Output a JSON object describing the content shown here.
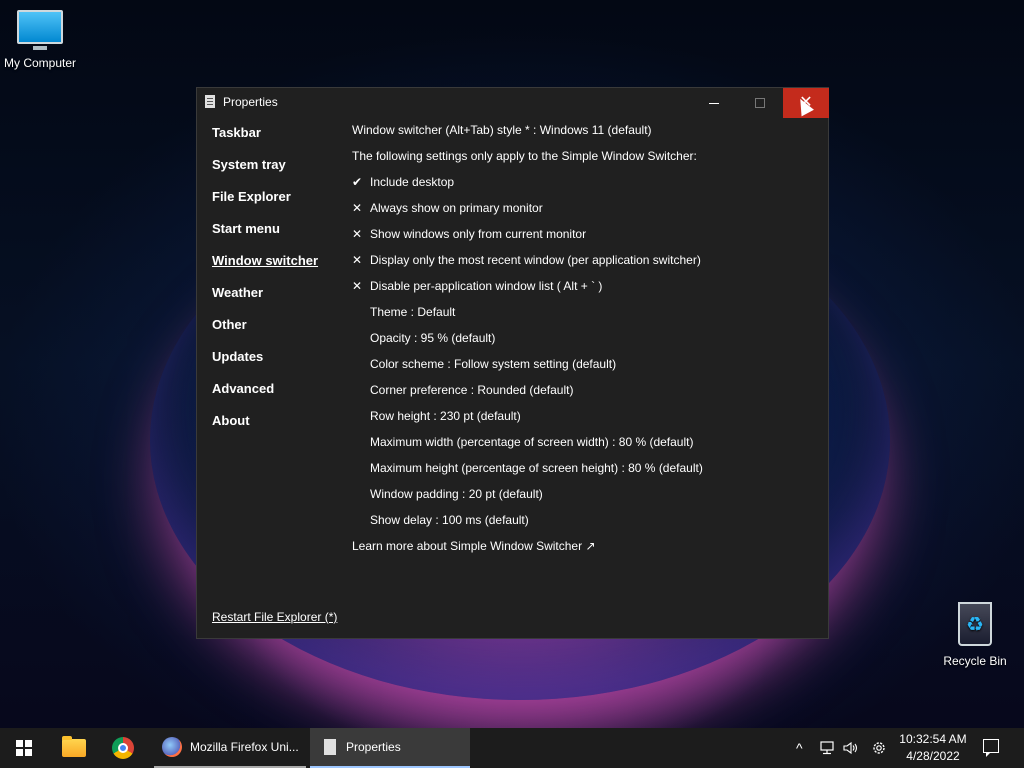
{
  "desktop": {
    "icons": [
      {
        "label": "My Computer"
      },
      {
        "label": "Recycle Bin"
      }
    ]
  },
  "window": {
    "title": "Properties",
    "close_glyph": "✕",
    "sidebar": [
      {
        "label": "Taskbar"
      },
      {
        "label": "System tray"
      },
      {
        "label": "File Explorer"
      },
      {
        "label": "Start menu"
      },
      {
        "label": "Window switcher"
      },
      {
        "label": "Weather"
      },
      {
        "label": "Other"
      },
      {
        "label": "Updates"
      },
      {
        "label": "Advanced"
      },
      {
        "label": "About"
      }
    ],
    "active_item": "Window switcher",
    "restart_label": "Restart File Explorer (*)",
    "settings": {
      "style_line": "Window switcher (Alt+Tab) style * : Windows 11 (default)",
      "note": "The following settings only apply to the Simple Window Switcher:",
      "options": [
        {
          "mark": "✔",
          "label": "Include desktop"
        },
        {
          "mark": "✕",
          "label": "Always show on primary monitor"
        },
        {
          "mark": "✕",
          "label": "Show windows only from current monitor"
        },
        {
          "mark": "✕",
          "label": "Display only the most recent window (per application switcher)"
        },
        {
          "mark": "✕",
          "label": "Disable per-application window list ( Alt + ` )"
        }
      ],
      "values": [
        "Theme : Default",
        "Opacity : 95 % (default)",
        "Color scheme : Follow system setting (default)",
        "Corner preference : Rounded (default)",
        "Row height : 230 pt (default)",
        "Maximum width (percentage of screen width) : 80 % (default)",
        "Maximum height (percentage of screen height) : 80 % (default)",
        "Window padding : 20 pt (default)",
        "Show delay : 100 ms (default)"
      ],
      "learn_more": "Learn more about Simple Window Switcher ↗"
    }
  },
  "taskbar": {
    "items": [
      {
        "label": "Mozilla Firefox Uni..."
      },
      {
        "label": "Properties"
      }
    ],
    "tray": {
      "chevron": "^",
      "time": "10:32:54 AM",
      "date": "4/28/2022"
    }
  },
  "colors": {
    "close_button": "#c42b1c",
    "window_bg": "#202020",
    "taskbar_bg": "#1c1c1c"
  }
}
